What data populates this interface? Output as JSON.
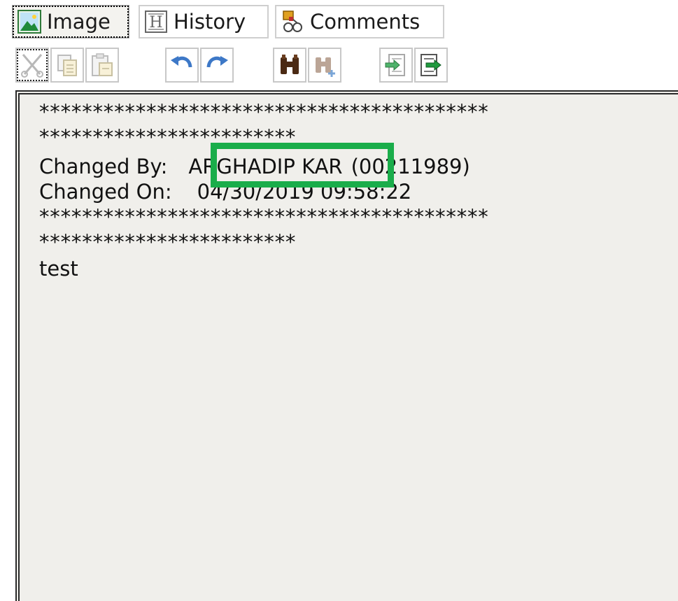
{
  "tabs": [
    {
      "label": "Image",
      "icon": "image-icon",
      "active": true
    },
    {
      "label": "History",
      "icon": "history-h-icon",
      "active": false
    },
    {
      "label": "Comments",
      "icon": "comments-icon",
      "active": false
    }
  ],
  "toolbar": {
    "buttons": [
      {
        "icon": "cut-icon",
        "enabled": false
      },
      {
        "icon": "copy-icon",
        "enabled": false
      },
      {
        "icon": "paste-icon",
        "enabled": false
      },
      {
        "icon": "undo-icon",
        "enabled": true
      },
      {
        "icon": "redo-icon",
        "enabled": true
      },
      {
        "icon": "find-binoculars-icon",
        "enabled": true
      },
      {
        "icon": "find-next-icon",
        "enabled": false
      },
      {
        "icon": "import-icon",
        "enabled": true
      },
      {
        "icon": "export-icon",
        "enabled": true
      }
    ]
  },
  "editor": {
    "stars_line_1": "******************************************",
    "stars_line_2": "************************",
    "changed_by_label": "Changed By:",
    "changed_by_name": "ARGHADIP KAR",
    "changed_by_id": "(00211989)",
    "changed_on_label": "Changed On:",
    "changed_on_value": "04/30/2019 09:58:22",
    "stars_line_3": "******************************************",
    "stars_line_4": "************************",
    "body_text": "test"
  },
  "colors": {
    "highlight_border": "#1aad4a",
    "editor_background": "#f0efeb"
  }
}
